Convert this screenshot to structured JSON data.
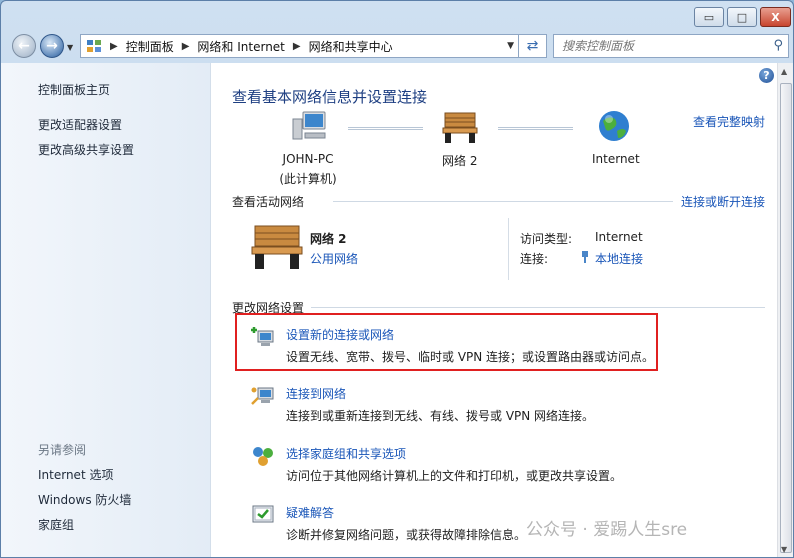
{
  "window": {
    "controls": {
      "minimize": "▭",
      "maximize": "□",
      "close": "X"
    }
  },
  "address": {
    "crumbs": [
      "控制面板",
      "网络和 Internet",
      "网络和共享中心"
    ],
    "search_placeholder": "搜索控制面板"
  },
  "sidebar": {
    "items": [
      "控制面板主页",
      "更改适配器设置",
      "更改高级共享设置"
    ],
    "see_also_header": "另请参阅",
    "see_also": [
      "Internet 选项",
      "Windows 防火墙",
      "家庭组"
    ]
  },
  "main": {
    "title": "查看基本网络信息并设置连接",
    "view_full_map": "查看完整映射",
    "map": {
      "pc_name": "JOHN-PC",
      "pc_sub": "(此计算机)",
      "network": "网络  2",
      "internet": "Internet"
    },
    "active_header": "查看活动网络",
    "connect_disconnect": "连接或断开连接",
    "active": {
      "name": "网络  2",
      "type": "公用网络",
      "access_label": "访问类型:",
      "access_value": "Internet",
      "conn_label": "连接:",
      "conn_value": "本地连接"
    },
    "change_header": "更改网络设置",
    "tasks": [
      {
        "title": "设置新的连接或网络",
        "desc": "设置无线、宽带、拨号、临时或 VPN 连接；或设置路由器或访问点。"
      },
      {
        "title": "连接到网络",
        "desc": "连接到或重新连接到无线、有线、拨号或 VPN 网络连接。"
      },
      {
        "title": "选择家庭组和共享选项",
        "desc": "访问位于其他网络计算机上的文件和打印机，或更改共享设置。"
      },
      {
        "title": "疑难解答",
        "desc": "诊断并修复网络问题，或获得故障排除信息。"
      }
    ]
  },
  "watermark": "公众号 · 爱踢人生sre",
  "colors": {
    "link": "#1a56b8",
    "title": "#1e3f82",
    "highlight": "#e02020"
  }
}
